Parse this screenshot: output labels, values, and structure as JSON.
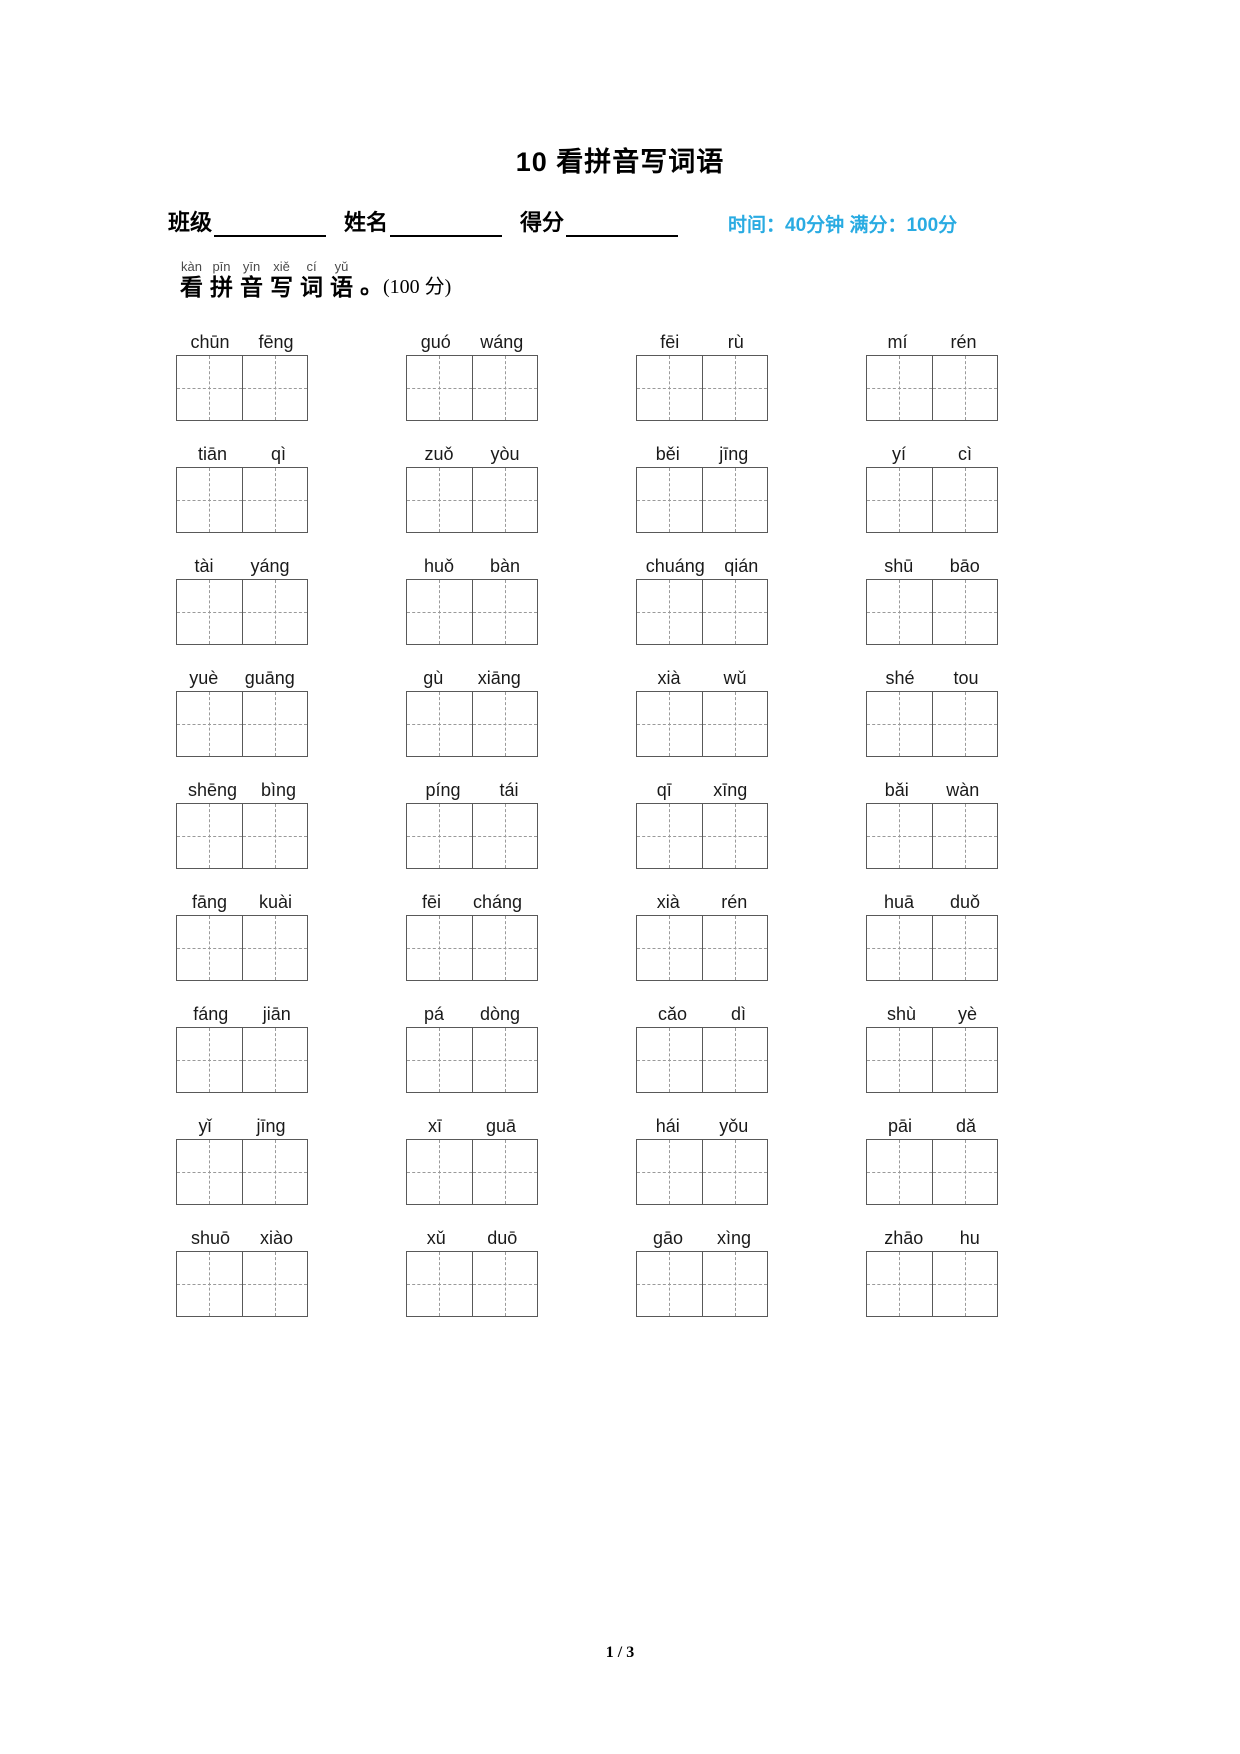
{
  "title": "10 看拼音写词语",
  "info": {
    "fields": [
      {
        "label": "班级"
      },
      {
        "label": "姓名"
      },
      {
        "label": "得分"
      }
    ],
    "meta": "时间：40分钟  满分：100分",
    "meta_color": "#29ABE2"
  },
  "instruction": {
    "ruby": [
      {
        "pinyin": "kàn",
        "char": "看"
      },
      {
        "pinyin": "pīn",
        "char": "拼"
      },
      {
        "pinyin": "yīn",
        "char": "音"
      },
      {
        "pinyin": "xiě",
        "char": "写"
      },
      {
        "pinyin": "cí",
        "char": "词"
      },
      {
        "pinyin": "yǔ",
        "char": "语"
      }
    ],
    "punctuation": "。",
    "score": "(100 分)"
  },
  "items": [
    {
      "syllables": [
        "chūn",
        "fēng"
      ],
      "cells": 2
    },
    {
      "syllables": [
        "guó",
        "wáng"
      ],
      "cells": 2
    },
    {
      "syllables": [
        "fēi",
        "rù"
      ],
      "cells": 2
    },
    {
      "syllables": [
        "mí",
        "rén"
      ],
      "cells": 2
    },
    {
      "syllables": [
        "tiān",
        "qì"
      ],
      "cells": 2
    },
    {
      "syllables": [
        "zuǒ",
        "yòu"
      ],
      "cells": 2
    },
    {
      "syllables": [
        "běi",
        "jīng"
      ],
      "cells": 2
    },
    {
      "syllables": [
        "yí",
        "cì"
      ],
      "cells": 2
    },
    {
      "syllables": [
        "tài",
        "yáng"
      ],
      "cells": 2
    },
    {
      "syllables": [
        "huǒ",
        "bàn"
      ],
      "cells": 2
    },
    {
      "syllables": [
        "chuáng",
        "qián"
      ],
      "cells": 2
    },
    {
      "syllables": [
        "shū",
        "bāo"
      ],
      "cells": 2
    },
    {
      "syllables": [
        "yuè",
        "guāng"
      ],
      "cells": 2
    },
    {
      "syllables": [
        "gù",
        "xiāng"
      ],
      "cells": 2
    },
    {
      "syllables": [
        "xià",
        "wǔ"
      ],
      "cells": 2
    },
    {
      "syllables": [
        "shé",
        "tou"
      ],
      "cells": 2
    },
    {
      "syllables": [
        "shēng",
        "bìng"
      ],
      "cells": 2
    },
    {
      "syllables": [
        "píng",
        "tái"
      ],
      "cells": 2
    },
    {
      "syllables": [
        "qī",
        "xīng"
      ],
      "cells": 2
    },
    {
      "syllables": [
        "bǎi",
        "wàn"
      ],
      "cells": 2
    },
    {
      "syllables": [
        "fāng",
        "kuài"
      ],
      "cells": 2
    },
    {
      "syllables": [
        "fēi",
        "cháng"
      ],
      "cells": 2
    },
    {
      "syllables": [
        "xià",
        "rén"
      ],
      "cells": 2
    },
    {
      "syllables": [
        "huā",
        "duǒ"
      ],
      "cells": 2
    },
    {
      "syllables": [
        "fáng",
        "jiān"
      ],
      "cells": 2
    },
    {
      "syllables": [
        "pá",
        "dòng"
      ],
      "cells": 2
    },
    {
      "syllables": [
        "cǎo",
        "dì"
      ],
      "cells": 2
    },
    {
      "syllables": [
        "shù",
        "yè"
      ],
      "cells": 2
    },
    {
      "syllables": [
        "yǐ",
        "jīng"
      ],
      "cells": 2
    },
    {
      "syllables": [
        "xī",
        "guā"
      ],
      "cells": 2
    },
    {
      "syllables": [
        "hái",
        "yǒu"
      ],
      "cells": 2
    },
    {
      "syllables": [
        "pāi",
        "dǎ"
      ],
      "cells": 2
    },
    {
      "syllables": [
        "shuō",
        "xiào"
      ],
      "cells": 2
    },
    {
      "syllables": [
        "xǔ",
        "duō"
      ],
      "cells": 2
    },
    {
      "syllables": [
        "gāo",
        "xìng"
      ],
      "cells": 2
    },
    {
      "syllables": [
        "zhāo",
        "hu"
      ],
      "cells": 2
    }
  ],
  "footer": {
    "page_number": "1 / 3"
  }
}
